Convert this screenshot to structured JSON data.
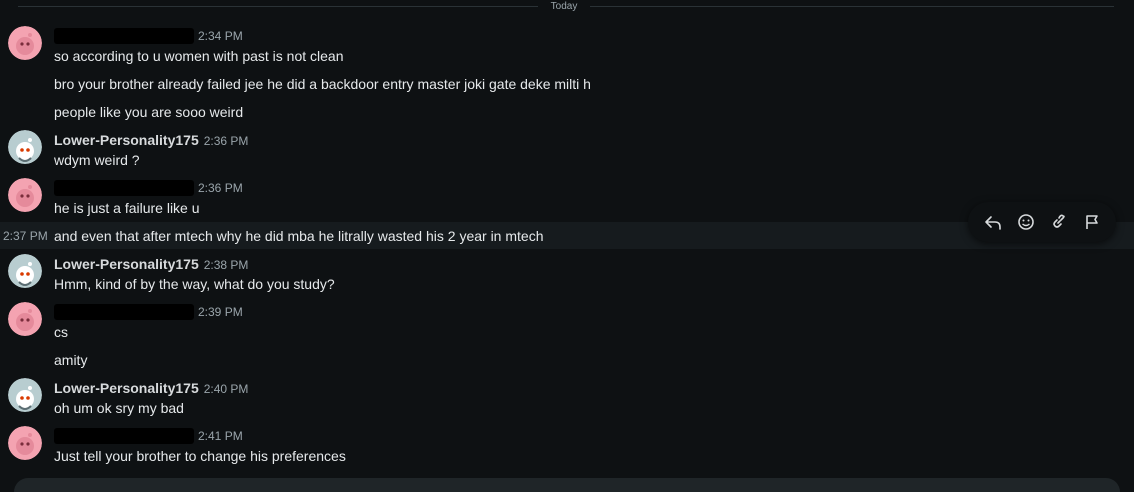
{
  "divider": {
    "label": "Today"
  },
  "messages": [
    {
      "kind": "other",
      "time": "2:34 PM",
      "lines": [
        "so according to u women with past is not clean",
        "bro your brother already failed jee he did a backdoor entry master joki gate deke milti h",
        "people like you are sooo weird"
      ]
    },
    {
      "kind": "self",
      "name": "Lower-Personality175",
      "time": "2:36 PM",
      "lines": [
        "wdym weird ?"
      ]
    },
    {
      "kind": "other",
      "time": "2:36 PM",
      "lines": [
        "he is just a failure like u"
      ]
    },
    {
      "kind": "hover",
      "time": "2:37 PM",
      "lines": [
        "and even that after mtech why he did mba he litrally wasted his 2 year in mtech"
      ]
    },
    {
      "kind": "self",
      "name": "Lower-Personality175",
      "time": "2:38 PM",
      "lines": [
        "Hmm, kind of by the way, what do you study?"
      ]
    },
    {
      "kind": "other",
      "time": "2:39 PM",
      "lines": [
        "cs",
        "amity"
      ]
    },
    {
      "kind": "self",
      "name": "Lower-Personality175",
      "time": "2:40 PM",
      "lines": [
        "oh um ok sry my bad"
      ]
    },
    {
      "kind": "other",
      "time": "2:41 PM",
      "lines": [
        "Just tell your brother to change his preferences"
      ]
    }
  ],
  "toolbar": {
    "icons": [
      "reply-icon",
      "emoji-icon",
      "link-icon",
      "flag-icon"
    ]
  },
  "colors": {
    "background": "#0e1113",
    "avatar_pink": "#f4a3b1",
    "avatar_self": "#b8cdd0"
  }
}
